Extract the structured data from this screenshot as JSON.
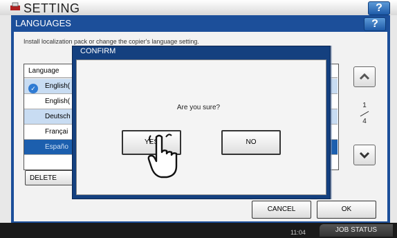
{
  "app": {
    "title": "SETTING",
    "help_label": "?"
  },
  "panel": {
    "title": "LANGUAGES",
    "help_label": "?",
    "description": "Install localization pack or change the copier's language setting."
  },
  "list": {
    "header": "Language",
    "rows": [
      {
        "label": "English(",
        "selected_check": true
      },
      {
        "label": "English("
      },
      {
        "label": "Deutsch"
      },
      {
        "label": "Françai"
      },
      {
        "label": "Españo"
      }
    ]
  },
  "pager": {
    "current": "1",
    "total": "4"
  },
  "buttons": {
    "delete": "DELETE",
    "cancel": "CANCEL",
    "ok": "OK"
  },
  "dialog": {
    "title": "CONFIRM",
    "question": "Are you sure?",
    "yes": "YES",
    "no": "NO"
  },
  "status": {
    "time": "11:04",
    "job_status": "JOB STATUS"
  },
  "colors": {
    "frame": "#1c4f9a",
    "selected_row": "#1c5fae",
    "row_alt": "#c8dcf2"
  },
  "icons": {
    "app": "printer-setting-icon",
    "check": "check-circle-icon",
    "up": "chevron-up-icon",
    "down": "chevron-down-icon",
    "cursor": "hand-pointer-icon"
  }
}
